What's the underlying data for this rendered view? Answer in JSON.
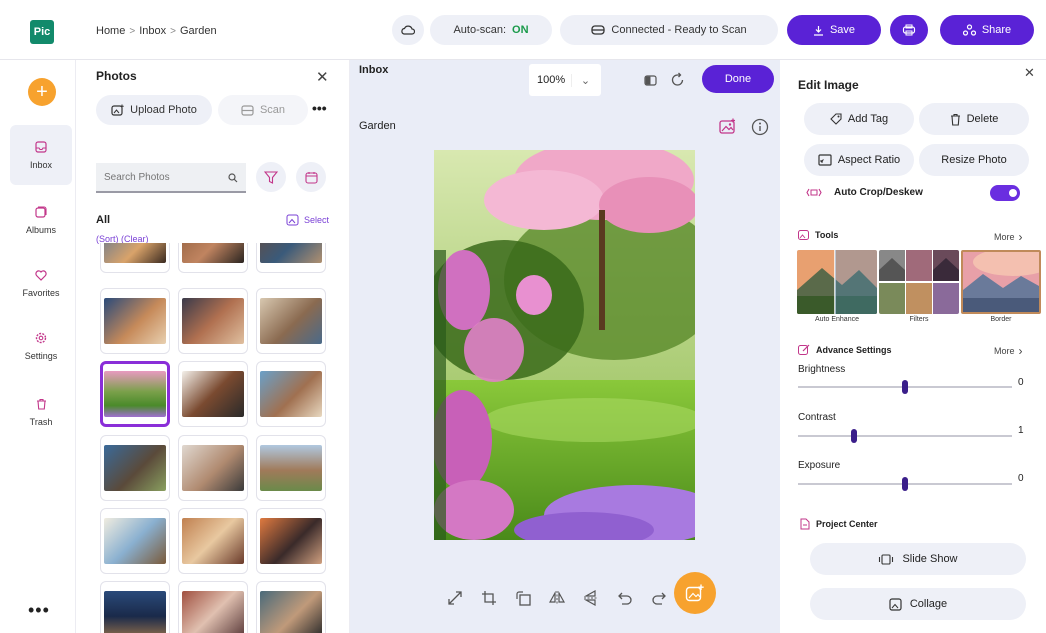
{
  "app": {
    "logo_text": "Pic"
  },
  "breadcrumb": [
    "Home",
    "Inbox",
    "Garden"
  ],
  "topbar": {
    "auto_scan_label": "Auto-scan:",
    "auto_scan_state": "ON",
    "connection_status": "Connected - Ready to Scan",
    "save_label": "Save",
    "share_label": "Share"
  },
  "nav": {
    "items": [
      {
        "label": "Inbox",
        "icon": "inbox-icon",
        "active": true
      },
      {
        "label": "Albums",
        "icon": "albums-icon"
      },
      {
        "label": "Favorites",
        "icon": "heart-icon"
      },
      {
        "label": "Settings",
        "icon": "gear-icon"
      },
      {
        "label": "Trash",
        "icon": "trash-icon"
      }
    ],
    "more": "•••"
  },
  "photos_panel": {
    "title": "Photos",
    "upload_label": "Upload Photo",
    "scan_label": "Scan",
    "more": "•••",
    "search_placeholder": "Search Photos",
    "filter_title": "All",
    "select_label": "Select",
    "sort_label": "(Sort)",
    "clear_label": "(Clear)"
  },
  "canvas": {
    "title": "Inbox",
    "subtitle": "Garden",
    "zoom": "100%",
    "done_label": "Done"
  },
  "edit_panel": {
    "title": "Edit Image",
    "add_tag_label": "Add Tag",
    "delete_label": "Delete",
    "aspect_ratio_label": "Aspect Ratio",
    "resize_label": "Resize Photo",
    "auto_crop_label": "Auto Crop/Deskew",
    "auto_crop_on": true,
    "tools_label": "Tools",
    "tools_more": "More",
    "filters": [
      "Auto Enhance",
      "Filters",
      "Border"
    ],
    "advance_label": "Advance Settings",
    "advance_more": "More",
    "sliders": [
      {
        "label": "Brightness",
        "value": "0",
        "position": 0.5
      },
      {
        "label": "Contrast",
        "value": "1",
        "position": 0.26
      },
      {
        "label": "Exposure",
        "value": "0",
        "position": 0.5
      }
    ],
    "project_center_label": "Project Center",
    "slideshow_label": "Slide Show",
    "collage_label": "Collage"
  },
  "colors": {
    "accent": "#5a22d6",
    "orange": "#f7a22e",
    "pink_icon": "#c2368a",
    "on_green": "#1a9a4a"
  }
}
